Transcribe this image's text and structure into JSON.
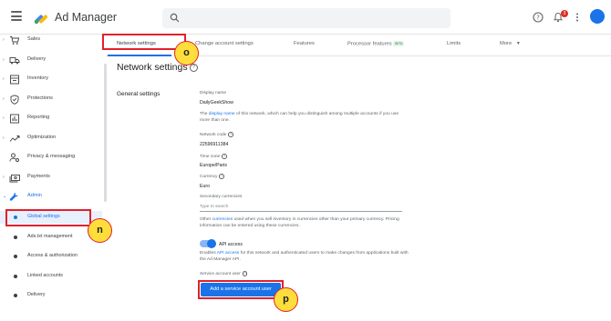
{
  "app": {
    "name": "Ad Manager"
  },
  "header": {
    "notification_count": "3"
  },
  "sidebar": {
    "items": [
      {
        "label": "Sales",
        "icon": "cart-icon"
      },
      {
        "label": "Delivery",
        "icon": "truck-icon"
      },
      {
        "label": "Inventory",
        "icon": "inventory-icon"
      },
      {
        "label": "Protections",
        "icon": "shield-icon"
      },
      {
        "label": "Reporting",
        "icon": "bar-chart-icon"
      },
      {
        "label": "Optimization",
        "icon": "trending-icon"
      },
      {
        "label": "Privacy & messaging",
        "icon": "person-settings-icon"
      },
      {
        "label": "Payments",
        "icon": "payments-icon"
      },
      {
        "label": "Admin",
        "icon": "wrench-icon"
      }
    ],
    "admin_items": [
      {
        "label": "Global settings",
        "active": true
      },
      {
        "label": "Ads.txt management"
      },
      {
        "label": "Access & authorization"
      },
      {
        "label": "Linked accounts"
      },
      {
        "label": "Delivery"
      }
    ]
  },
  "tabs": [
    {
      "label": "Network settings",
      "active": true
    },
    {
      "label": "Change account settings"
    },
    {
      "label": "Features"
    },
    {
      "label": "Processor features",
      "badge": "BETA"
    },
    {
      "label": "Limits"
    },
    {
      "label": "More"
    }
  ],
  "page": {
    "title": "Network settings",
    "section": "General settings"
  },
  "fields": {
    "display_name_label": "Display name",
    "display_name_value": "DailyGeekShow",
    "display_name_help_prefix": "The ",
    "display_name_help_link": "display name",
    "display_name_help_suffix": " of this network, which can help you distinguish among multiple accounts if you use more than one.",
    "network_code_label": "Network code",
    "network_code_value": "22596911384",
    "time_zone_label": "Time zone",
    "time_zone_value": "Europe/Paris",
    "currency_label": "Currency",
    "currency_value": "Euro",
    "secondary_currencies_label": "Secondary currencies",
    "secondary_currencies_placeholder": "Type to search",
    "currencies_help_prefix": "Other ",
    "currencies_help_link": "currencies",
    "currencies_help_suffix": " used when you sell inventory in currencies other than your primary currency. Pricing information can be entered using these currencies.",
    "api_access_label": "API access",
    "api_help_prefix": "Enables ",
    "api_help_link": "API access",
    "api_help_suffix": " for this network and authenticated users to make changes from applications built with the Ad Manager API.",
    "service_account_label": "Service account user",
    "add_service_account_button": "Add a service account user"
  },
  "annotations": {
    "n": "n",
    "o": "o",
    "p": "p"
  },
  "colors": {
    "accent": "#1a73e8",
    "highlight": "#e2202c",
    "marker": "#ffde3b"
  }
}
